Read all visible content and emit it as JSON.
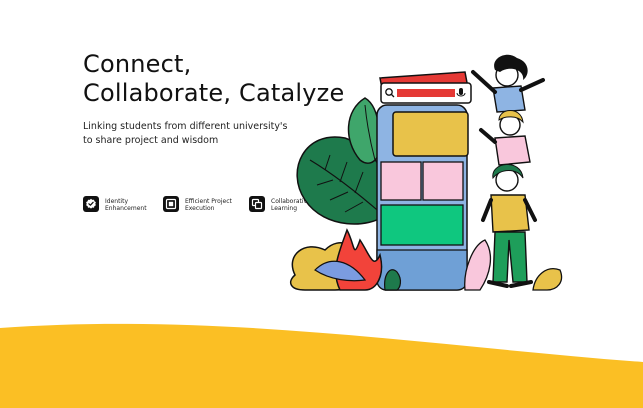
{
  "hero": {
    "title_line1": "Connect,",
    "title_line2": "Collaborate, Catalyze",
    "subtitle_line1": "Linking students from different university's",
    "subtitle_line2": "to share project and wisdom"
  },
  "features": [
    {
      "label_line1": "Identity",
      "label_line2": "Enhancement",
      "icon": "verified-badge-icon"
    },
    {
      "label_line1": "Efficient Project",
      "label_line2": "Execution",
      "icon": "project-frame-icon"
    },
    {
      "label_line1": "Collaborative",
      "label_line2": "Learning",
      "icon": "layered-squares-icon"
    }
  ],
  "colors": {
    "accent_yellow": "#FBBF24",
    "search_red": "#E53935",
    "phone_blue": "#8EB4E3",
    "card_yellow": "#E8C24A",
    "card_pink": "#F9C7DC",
    "card_green": "#0FC77F",
    "leaf_green": "#1E7A4C",
    "leaf_red": "#F2433A",
    "text_dark": "#111111"
  }
}
